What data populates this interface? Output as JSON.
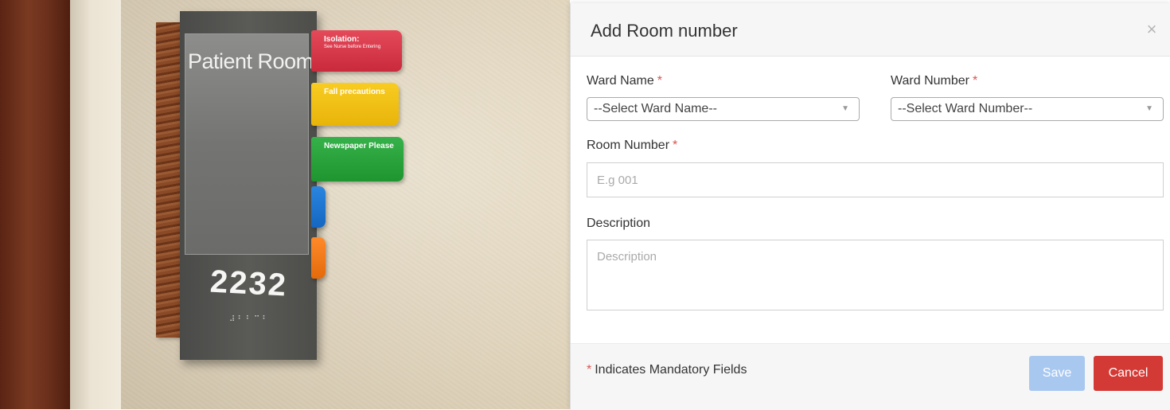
{
  "photo": {
    "sign_title": "Patient Room",
    "room_number": "2232",
    "braille": "⠼⠃⠃⠉⠃",
    "tabs": {
      "isolation_title": "Isolation:",
      "isolation_sub": "See Nurse before Entering",
      "fall": "Fall precautions",
      "newspaper": "Newspaper Please"
    }
  },
  "modal": {
    "title": "Add Room number",
    "close_symbol": "×",
    "ward_name": {
      "label": "Ward Name",
      "required_mark": "*",
      "selected": "--Select Ward Name--"
    },
    "ward_number": {
      "label": "Ward Number",
      "required_mark": "*",
      "selected": "--Select Ward Number--"
    },
    "room_number": {
      "label": "Room Number",
      "required_mark": "*",
      "placeholder": "E.g 001",
      "value": ""
    },
    "description": {
      "label": "Description",
      "placeholder": "Description",
      "value": ""
    },
    "footer": {
      "mandatory_star": "*",
      "mandatory_note": "Indicates Mandatory Fields",
      "save_label": "Save",
      "cancel_label": "Cancel"
    }
  },
  "colors": {
    "required": "#d9534f",
    "save_button": "#a9c8f0",
    "cancel_button": "#d43a35"
  },
  "icons": {
    "close": "close-icon",
    "select_arrow": "chevron-down-icon"
  }
}
